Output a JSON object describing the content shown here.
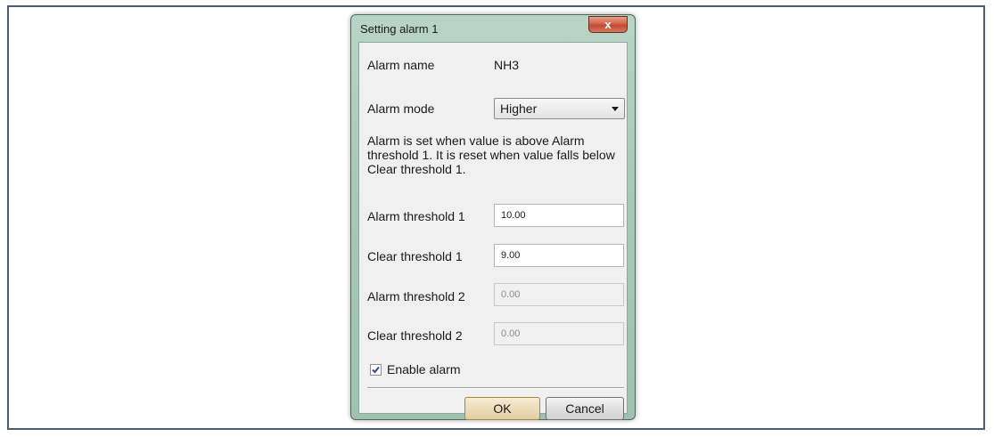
{
  "dialog": {
    "title": "Setting alarm 1",
    "close_label": "x"
  },
  "fields": {
    "alarm_name_label": "Alarm name",
    "alarm_name_value": "NH3",
    "alarm_mode_label": "Alarm mode",
    "alarm_mode_selected": "Higher",
    "description": "Alarm is set when value is above Alarm threshold 1. It is reset when value falls below Clear threshold 1.",
    "alarm_threshold_1_label": "Alarm threshold 1",
    "alarm_threshold_1_value": "10.00",
    "clear_threshold_1_label": "Clear threshold 1",
    "clear_threshold_1_value": "9.00",
    "alarm_threshold_2_label": "Alarm threshold 2",
    "alarm_threshold_2_value": "0.00",
    "clear_threshold_2_label": "Clear threshold 2",
    "clear_threshold_2_value": "0.00",
    "enable_alarm_label": "Enable alarm",
    "enable_alarm_checked": true
  },
  "buttons": {
    "ok_label": "OK",
    "cancel_label": "Cancel"
  },
  "icons": {
    "close": "close-icon",
    "dropdown": "chevron-down-icon",
    "check": "checkmark-icon"
  },
  "colors": {
    "window_frame": "#a9c9b8",
    "close_button": "#c14a33",
    "default_button": "#ecdcb8"
  }
}
